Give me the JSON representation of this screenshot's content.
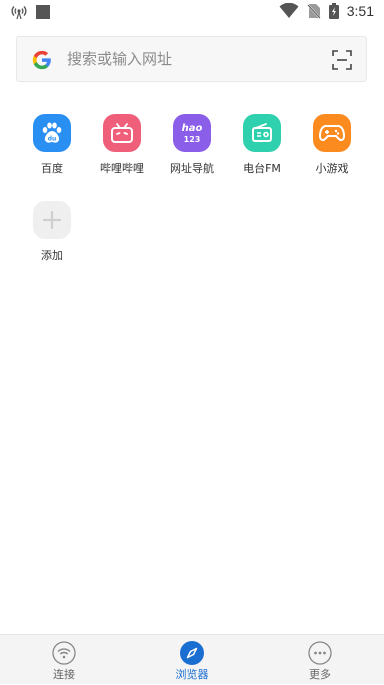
{
  "status_bar": {
    "time": "3:51"
  },
  "search": {
    "placeholder": "搜索或输入网址"
  },
  "shortcuts": [
    {
      "label": "百度",
      "icon": "baidu-paw-icon",
      "color": "#2a8ff3"
    },
    {
      "label": "哔哩哔哩",
      "icon": "bilibili-tv-icon",
      "color": "#ef5f7a"
    },
    {
      "label": "网址导航",
      "icon": "hao123-icon",
      "color": "#8a5ee9",
      "logo_text": "hao",
      "logo_num": "123"
    },
    {
      "label": "电台FM",
      "icon": "radio-icon",
      "color": "#2fd0ad"
    },
    {
      "label": "小游戏",
      "icon": "gamepad-icon",
      "color": "#fb8a1f"
    },
    {
      "label": "添加",
      "icon": "plus-icon",
      "color": "#efefef"
    }
  ],
  "bottom_nav": [
    {
      "label": "连接",
      "icon": "wifi-icon",
      "active": false
    },
    {
      "label": "浏览器",
      "icon": "compass-icon",
      "active": true
    },
    {
      "label": "更多",
      "icon": "more-dots-icon",
      "active": false
    }
  ],
  "colors": {
    "accent": "#1b6ed1",
    "baidu": "#2a8ff3",
    "bilibili": "#ef5f7a",
    "hao123": "#8a5ee9",
    "radio": "#2fd0ad",
    "game": "#fb8a1f"
  }
}
